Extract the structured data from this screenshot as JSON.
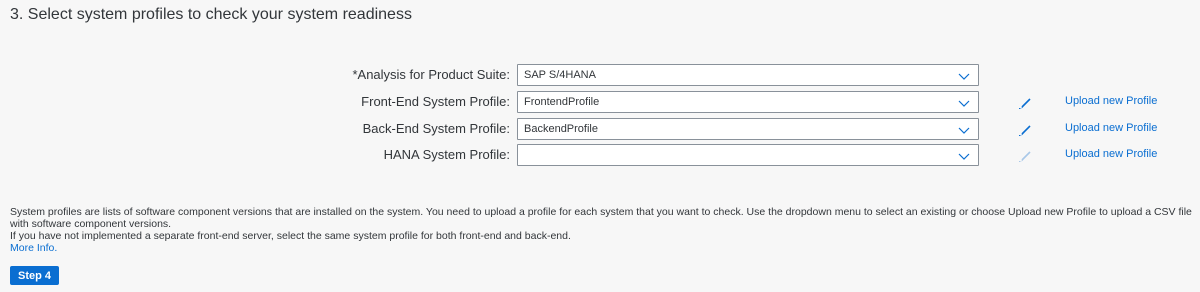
{
  "section": {
    "title": "3. Select system profiles to check your system readiness"
  },
  "form": {
    "rows": [
      {
        "label": "*Analysis for Product Suite:",
        "value": "SAP S/4HANA",
        "has_upload": false
      },
      {
        "label": "Front-End System Profile:",
        "value": "FrontendProfile",
        "has_upload": true,
        "upload_label": "Upload new Profile",
        "edit_enabled": true
      },
      {
        "label": "Back-End System Profile:",
        "value": "BackendProfile",
        "has_upload": true,
        "upload_label": "Upload new Profile",
        "edit_enabled": true
      },
      {
        "label": "HANA System Profile:",
        "value": "",
        "has_upload": true,
        "upload_label": "Upload new Profile",
        "edit_enabled": false
      }
    ]
  },
  "info": {
    "paragraph1": "System profiles are lists of software component versions that are installed on the system. You need to upload a profile for each system that you want to check. Use the dropdown menu to select an existing or choose Upload new Profile to upload a CSV file with software component versions.",
    "paragraph2": "If you have not implemented a separate front-end server, select the same system profile for both front-end and back-end.",
    "more_info": "More Info."
  },
  "step_button": {
    "label": "Step 4"
  },
  "colors": {
    "accent": "#0a6ed1",
    "background": "#f7f7f7",
    "text": "#32363a",
    "edit_enabled": "#0a6ed1",
    "edit_disabled": "#a9c8e8"
  }
}
